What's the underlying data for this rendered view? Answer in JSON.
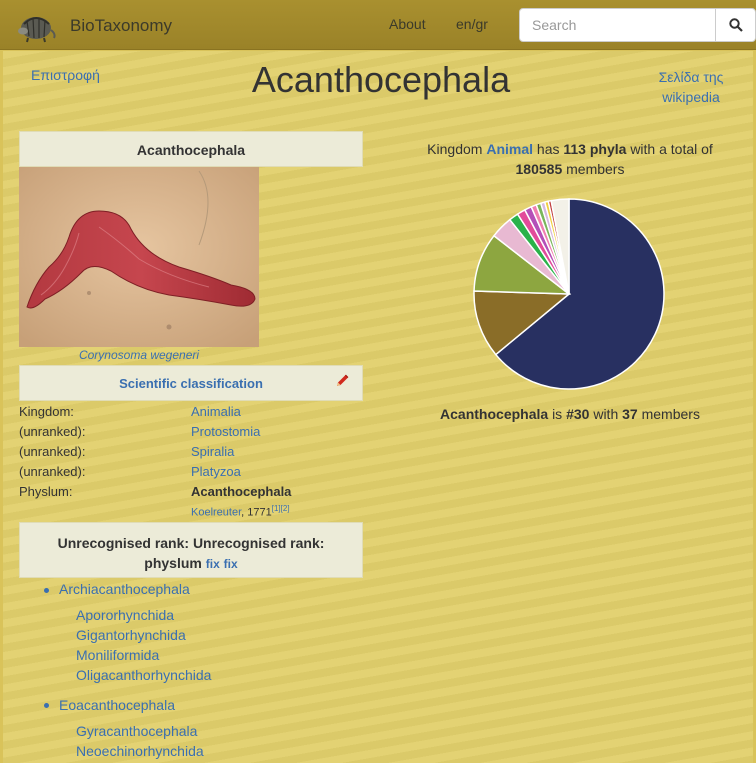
{
  "navbar": {
    "brand": "BioTaxonomy",
    "about": "About",
    "lang": "en/gr",
    "search_placeholder": "Search"
  },
  "header": {
    "back": "Επιστροφή",
    "title": "Acanthocephala",
    "wiki_line1": "Σελίδα της",
    "wiki_line2": "wikipedia"
  },
  "infobox": {
    "title": "Acanthocephala",
    "caption": "Corynosoma wegeneri",
    "classification_heading": "Scientific classification",
    "ranks": [
      {
        "rank": "Kingdom:",
        "value": "Animalia"
      },
      {
        "rank": "(unranked):",
        "value": "Protostomia"
      },
      {
        "rank": "(unranked):",
        "value": "Spiralia"
      },
      {
        "rank": "(unranked):",
        "value": "Platyzoa"
      },
      {
        "rank": "Physlum:",
        "value": "Acanthocephala"
      }
    ],
    "authority_link": "Koelreuter",
    "authority_year": ", 1771",
    "refs": "[1][2]",
    "unrecognised_line1": "Unrecognised rank: Unrecognised rank:",
    "unrecognised_line2": "physlum",
    "fix1": "fix",
    "fix2": "fix"
  },
  "subtaxa": [
    {
      "name": "Archiacanthocephala",
      "children": [
        "Apororhynchida",
        "Gigantorhynchida",
        "Moniliformida",
        "Oligacanthorhynchida"
      ]
    },
    {
      "name": "Eoacanthocephala",
      "children": [
        "Gyracanthocephala",
        "Neoechinorhynchida"
      ]
    }
  ],
  "stats": {
    "kingdom_prefix": "Kingdom",
    "kingdom_name": "Animal",
    "has": "has",
    "phyla_count": "113 phyla",
    "total_text": "with a total of",
    "members_total": "180585",
    "members_word": "members",
    "taxon": "Acanthocephala",
    "is_text": "is",
    "rank": "#30",
    "with_text": "with",
    "taxon_members": "37",
    "members_word2": "members"
  },
  "chart_data": {
    "type": "pie",
    "values": [
      64.0,
      11.5,
      10.0,
      3.8,
      1.6,
      1.4,
      1.2,
      0.9,
      0.8,
      0.7,
      0.6,
      0.5,
      3.0
    ],
    "colors": [
      "#283061",
      "#8a6d28",
      "#8da640",
      "#e8b9d2",
      "#2ab24a",
      "#e24b9a",
      "#b44fb8",
      "#f07fb0",
      "#7ab65b",
      "#d6b8e0",
      "#f0d040",
      "#c04040",
      "#f3f1e8"
    ]
  }
}
